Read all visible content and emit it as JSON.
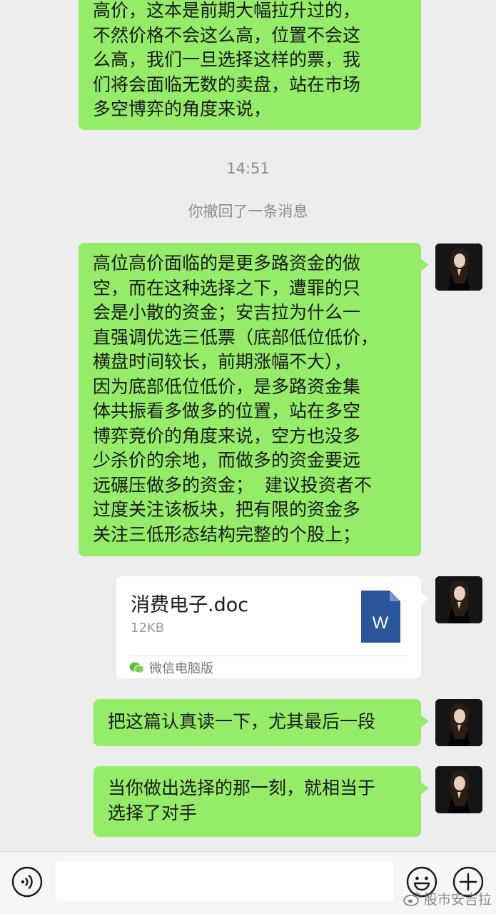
{
  "messages": {
    "m1": "高价，这本是前期大幅拉升过的，\n不然价格不会这么高，位置不会这\n么高，我们一旦选择这样的票，我\n们将会面临无数的卖盘，站在市场\n多空博弈的角度来说，",
    "time": "14:51",
    "recall": "你撤回了一条消息",
    "m2": "高位高价面临的是更多路资金的做\n空，而在这种选择之下，遭罪的只\n会是小散的资金；安吉拉为什么一\n直强调优选三低票（底部低位低价，\n横盘时间较长，前期涨幅不大），\n因为底部低位低价，是多路资金集\n体共振看多做多的位置，站在多空\n博弈竞价的角度来说，空方也没多\n少杀价的余地，而做多的资金要远\n远碾压做多的资金；  建议投资者不\n过度关注该板块，把有限的资金多\n关注三低形态结构完整的个股上；",
    "m3": "把这篇认真读一下，尤其最后一段",
    "m4": "当你做出选择的那一刻，就相当于\n选择了对手"
  },
  "file": {
    "name": "消费电子.doc",
    "size": "12KB",
    "icon_letter": "W",
    "source": "微信电脑版"
  },
  "watermark": "股市安吉拉",
  "colors": {
    "background": "#ededed",
    "bubble_self": "#95ec69",
    "word_icon": "#2b579a"
  }
}
